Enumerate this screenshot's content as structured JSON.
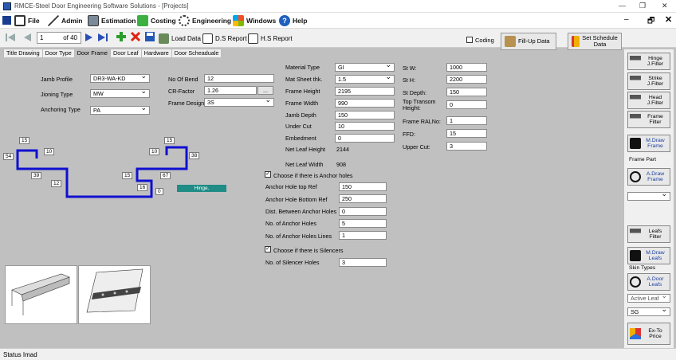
{
  "window": {
    "title": "RMCE-Steel Door Engineering Software Solutions - [Projects]"
  },
  "menu": {
    "file": "File",
    "admin": "Admin",
    "estimation": "Estimation",
    "costing": "Costing",
    "engineering": "Engineering",
    "windows": "Windows",
    "help": "Help"
  },
  "toolbar": {
    "record": "1",
    "of": "of 40",
    "load_data": "Load Data",
    "ds_report": "D.S Report",
    "hs_report": "H.S Report",
    "coding": "Coding",
    "fillup": "Fill-Up Data",
    "set_schedule": "Set Schedule Data"
  },
  "tabs": [
    "Title Drawing",
    "Door Type",
    "Door Frame",
    "Door Leaf",
    "Hardware",
    "Door Scheaduale"
  ],
  "left": {
    "jamb_profile_label": "Jamb Profile",
    "jamb_profile": "DR3-WA-KD",
    "jioning_label": "Jioning Type",
    "jioning": "MW",
    "anchoring_label": "Anchoring Type",
    "anchoring": "PA"
  },
  "mid": {
    "bend_label": "No Of Bend",
    "bend": "12",
    "cr_label": "CR-Factor",
    "cr": "1.26",
    "cr_btn": "...",
    "design_label": "Frame Design",
    "design": "3S"
  },
  "profile": {
    "d15a": "15",
    "d10a": "10",
    "d54": "54",
    "d39": "39",
    "d12": "12",
    "d10b": "10",
    "d15b": "15",
    "d38": "38",
    "d15c": "15",
    "d67": "67",
    "d16": "16",
    "d0": "0",
    "hinge": "Hinge."
  },
  "frame": {
    "material_label": "Material Type",
    "material": "GI",
    "sheet_label": "Mat Sheet thk.",
    "sheet": "1.5",
    "height_label": "Frame Height",
    "height": "2195",
    "width_label": "Frame Width",
    "width": "990",
    "jamb_label": "Jamb Depth",
    "jamb": "150",
    "under_label": "Under Cut",
    "under": "10",
    "embed_label": "Embedment",
    "embed": "0",
    "nlh_label": "Net Leaf Height",
    "nlh": "2144",
    "nlw_label": "Net Leaf Width",
    "nlw": "908"
  },
  "st": {
    "w_label": "St W:",
    "w": "1000",
    "h_label": "St H:",
    "h": "2200",
    "d_label": "St Depth:",
    "d": "150",
    "tt_label": "Top Transom Height:",
    "tt": "0",
    "ral_label": "Frame RALNo:",
    "ral": "1",
    "ffd_label": "FFD:",
    "ffd": "15",
    "uc_label": "Upper Cut:",
    "uc": "3"
  },
  "anchor": {
    "check_label": "Choose if there is Anchor holes",
    "top_label": "Anchor Hole top Ref",
    "top": "150",
    "bottom_label": "Anchor Hole Bottom Ref",
    "bottom": "250",
    "dist_label": "Dist. Between Anchor Holes",
    "dist": "0",
    "count_label": "No. of Anchor Holes",
    "count": "5",
    "lines_label": "No. of Anchor Holes Lines",
    "lines": "1"
  },
  "silencer": {
    "check_label": "Choose if there is Silencers",
    "holes_label": "No. of Silencer Holes",
    "holes": "3"
  },
  "side": {
    "hinge": "Hinge J.Filter",
    "strike": "Strike J.Filter",
    "head": "Head J.Filter",
    "frame": "Frame Filter",
    "mdraw_frame": "M.Draw Frame",
    "frame_part": "Frame Part",
    "adraw_frame": "A.Draw Frame",
    "leafs": "Leafs Filter",
    "mdraw_leafs": "M.Draw Leafs",
    "skin_types": "Skin Types",
    "adoor_leafs": "A.Door Leafs",
    "active_leaf": "Active Leaf",
    "sg": "SG",
    "ex_to_price": "Ex-To Price"
  },
  "status": "Status  Imad"
}
